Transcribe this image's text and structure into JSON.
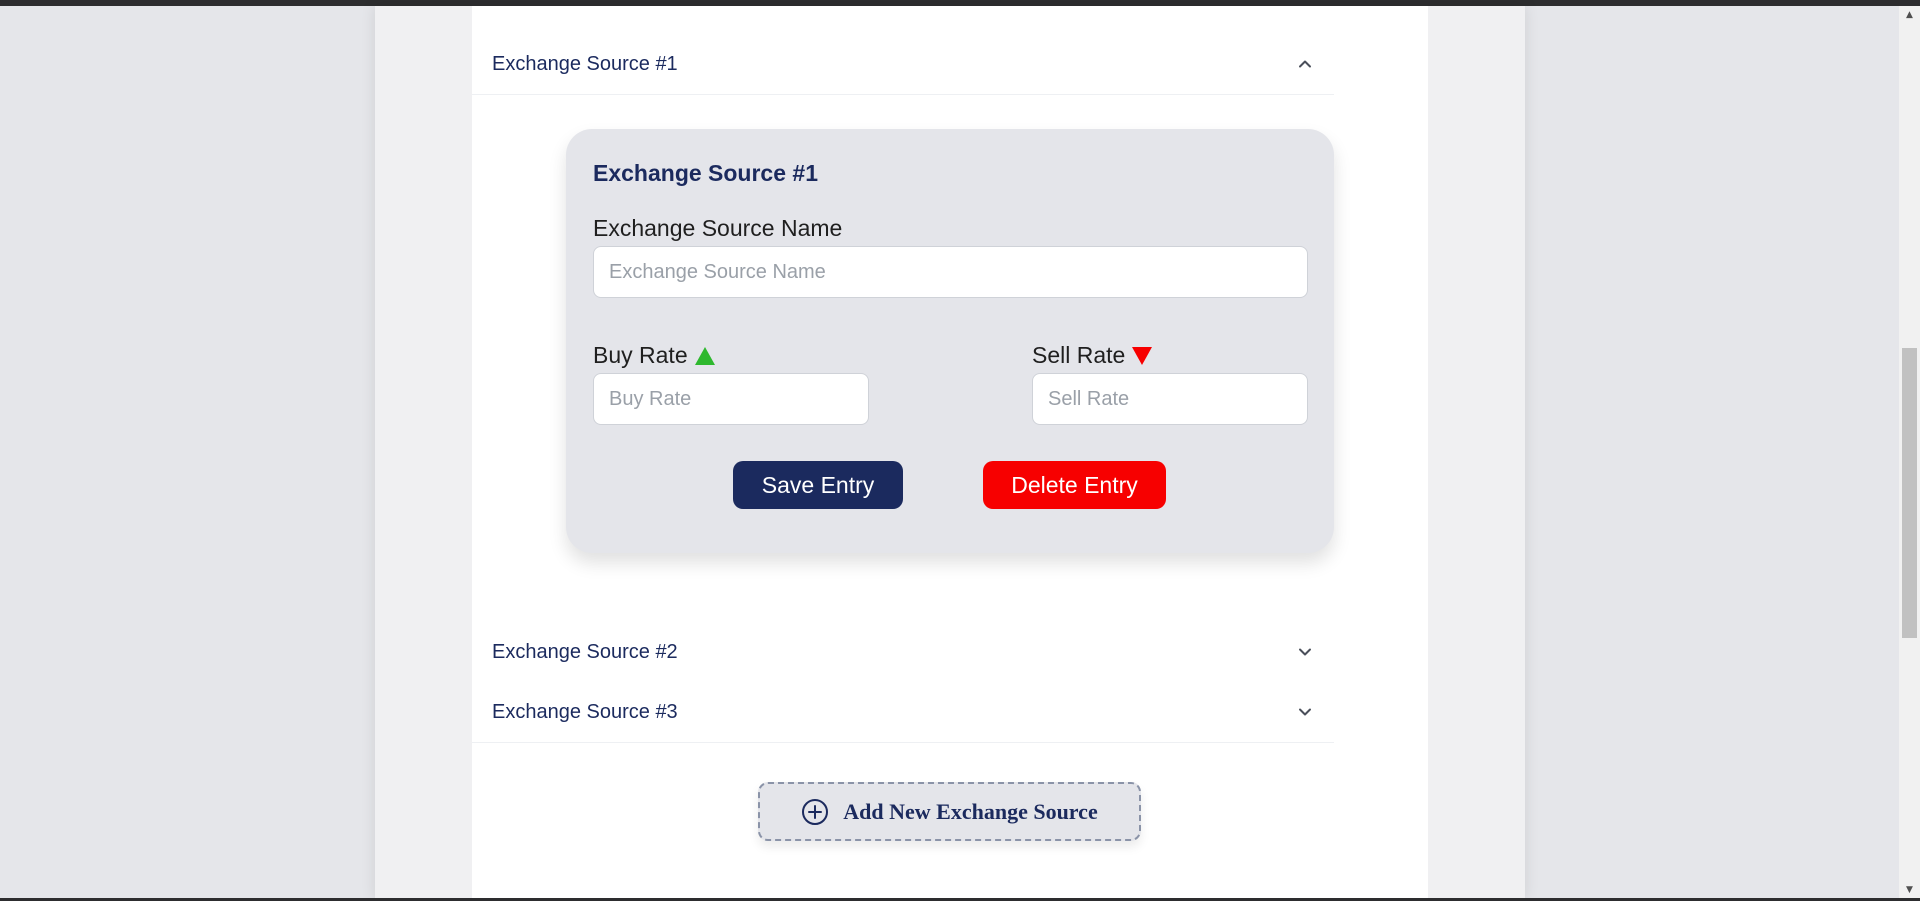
{
  "accordion": {
    "items": [
      {
        "label": "Exchange Source #1",
        "expanded": true,
        "chevron_icon": "chevron-up-icon"
      },
      {
        "label": "Exchange Source #2",
        "expanded": false,
        "chevron_icon": "chevron-down-icon"
      },
      {
        "label": "Exchange Source #3",
        "expanded": false,
        "chevron_icon": "chevron-down-icon"
      }
    ]
  },
  "form": {
    "title": "Exchange Source #1",
    "name_label": "Exchange Source Name",
    "name_placeholder": "Exchange Source Name",
    "name_value": "",
    "buy_label": "Buy Rate",
    "buy_icon": "triangle-up-icon",
    "buy_placeholder": "Buy Rate",
    "buy_value": "",
    "sell_label": "Sell Rate",
    "sell_icon": "triangle-down-icon",
    "sell_placeholder": "Sell Rate",
    "sell_value": "",
    "save_label": "Save Entry",
    "delete_label": "Delete Entry"
  },
  "add_button": {
    "label": "Add New Exchange Source",
    "icon": "plus-circle-icon"
  },
  "colors": {
    "primary": "#1b2a5e",
    "danger": "#f70000",
    "buy_indicator": "#2eb82e",
    "sell_indicator": "#f70000",
    "card_bg": "#e4e5ea",
    "page_bg": "#e5e6ea"
  }
}
